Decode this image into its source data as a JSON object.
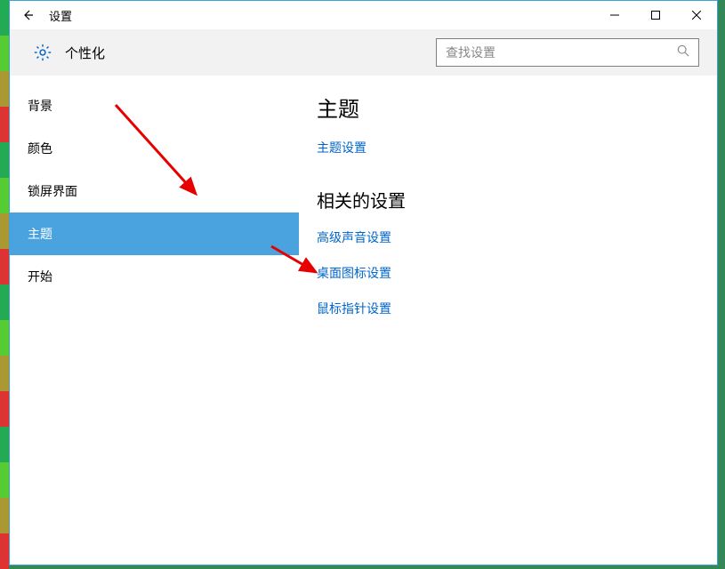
{
  "window": {
    "title": "设置"
  },
  "section": {
    "name": "个性化"
  },
  "search": {
    "placeholder": "查找设置"
  },
  "sidebar": {
    "items": [
      {
        "label": "背景",
        "active": false
      },
      {
        "label": "颜色",
        "active": false
      },
      {
        "label": "锁屏界面",
        "active": false
      },
      {
        "label": "主题",
        "active": true
      },
      {
        "label": "开始",
        "active": false
      }
    ]
  },
  "content": {
    "heading": "主题",
    "primary_link": "主题设置",
    "related_heading": "相关的设置",
    "related_links": [
      "高级声音设置",
      "桌面图标设置",
      "鼠标指针设置"
    ]
  }
}
